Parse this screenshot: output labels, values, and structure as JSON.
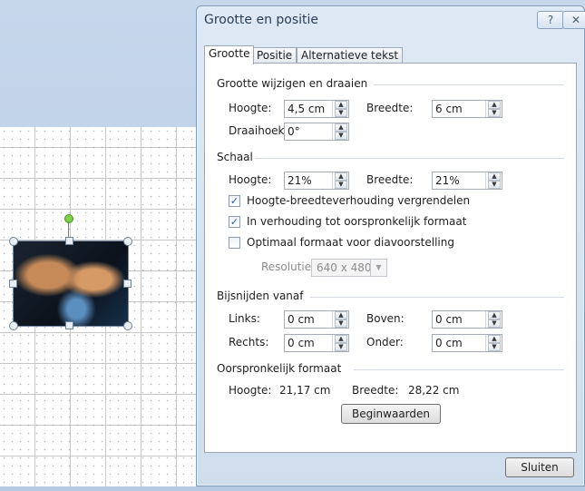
{
  "dialog": {
    "title": "Grootte en positie",
    "help_glyph": "?",
    "close_glyph": "✕",
    "tabs": [
      {
        "label": "Grootte",
        "active": true
      },
      {
        "label": "Positie",
        "active": false
      },
      {
        "label": "Alternatieve tekst",
        "active": false
      }
    ],
    "resize_rotate": {
      "heading": "Grootte wijzigen en draaien",
      "height_label": "Hoogte:",
      "height_value": "4,5 cm",
      "width_label": "Breedte:",
      "width_value": "6 cm",
      "rotation_label": "Draaihoek:",
      "rotation_value": "0°"
    },
    "scale": {
      "heading": "Schaal",
      "height_label": "Hoogte:",
      "height_value": "21%",
      "width_label": "Breedte:",
      "width_value": "21%",
      "lock_aspect_label": "Hoogte-breedteverhouding vergrendelen",
      "lock_aspect_checked": true,
      "relative_original_label": "In verhouding tot oorspronkelijk formaat",
      "relative_original_checked": true,
      "best_scale_label": "Optimaal formaat voor diavoorstelling",
      "best_scale_checked": false,
      "resolution_label": "Resolutie",
      "resolution_value": "640 x 480"
    },
    "crop": {
      "heading": "Bijsnijden vanaf",
      "left_label": "Links:",
      "left_value": "0 cm",
      "top_label": "Boven:",
      "top_value": "0 cm",
      "right_label": "Rechts:",
      "right_value": "0 cm",
      "bottom_label": "Onder:",
      "bottom_value": "0 cm"
    },
    "original": {
      "heading": "Oorspronkelijk formaat",
      "height_label": "Hoogte:",
      "height_value": "21,17 cm",
      "width_label": "Breedte:",
      "width_value": "28,22 cm",
      "reset_label": "Beginwaarden"
    },
    "close_label": "Sluiten"
  },
  "colors": {
    "check_mark": "#2458a6",
    "rotate_handle": "#7dd14a"
  }
}
